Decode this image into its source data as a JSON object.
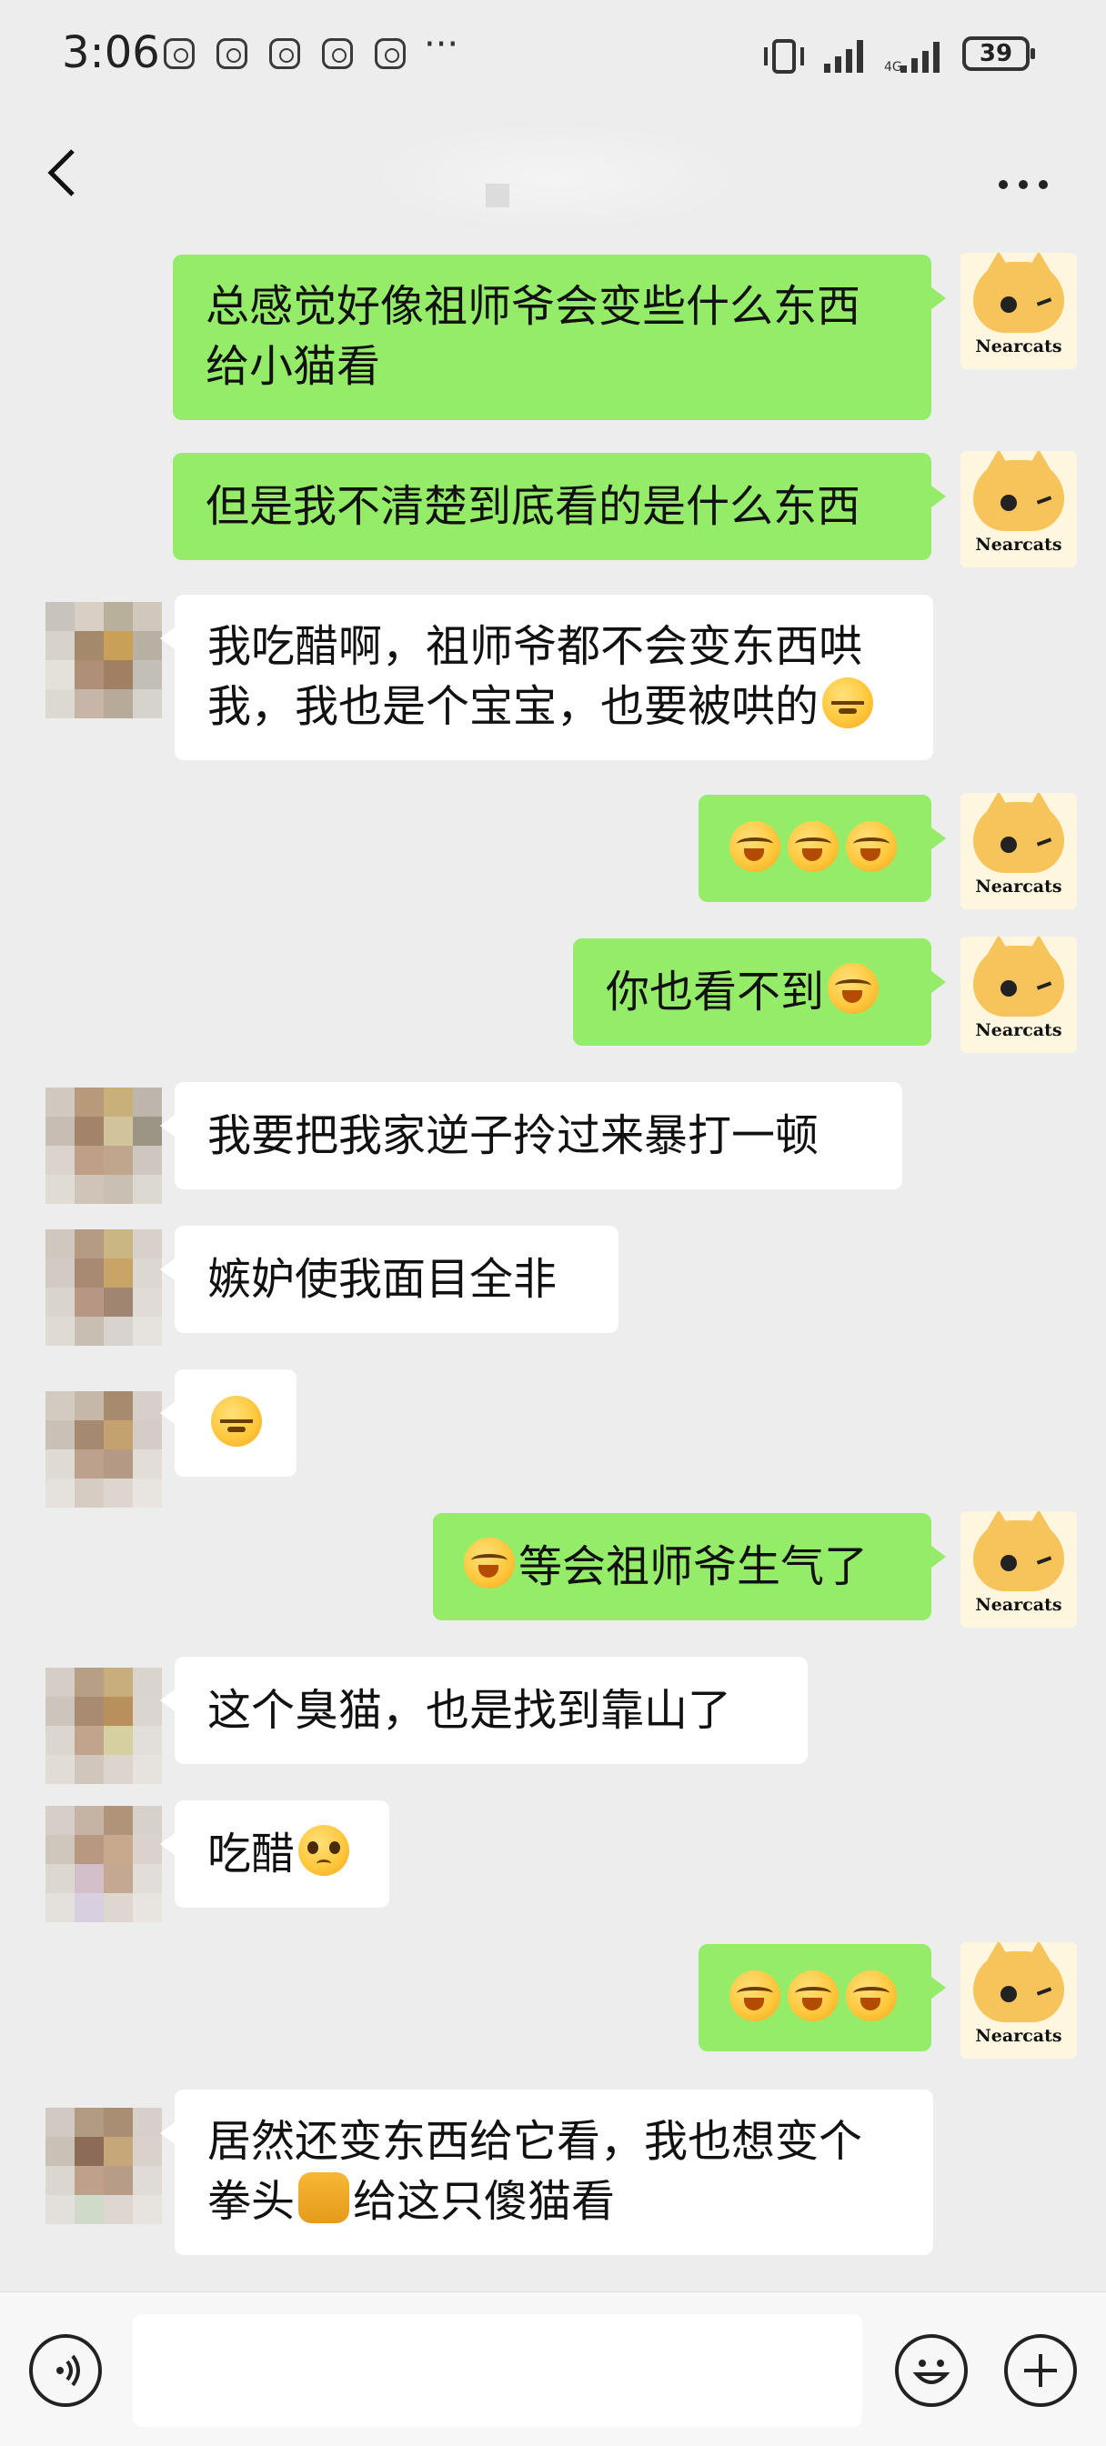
{
  "status_bar": {
    "time": "3:06",
    "overflow": "···",
    "battery": "39"
  },
  "header": {
    "back_icon": "chevron-left-icon",
    "menu_icon": "more-dots-icon"
  },
  "my_avatar_label": "Nearcats",
  "messages": [
    {
      "sender": "me",
      "lines": [
        "总感觉好像祖师爷会变些什么东西",
        "给小猫看"
      ]
    },
    {
      "sender": "me",
      "lines": [
        "但是我不清楚到底看的是什么东西"
      ]
    },
    {
      "sender": "them",
      "lines": [
        "我吃醋啊，祖师爷都不会变东西哄",
        "我，我也是个宝宝，也要被哄的"
      ],
      "emoji": "angry-crying-emoji"
    },
    {
      "sender": "me",
      "lines": [
        ""
      ],
      "emoji": "laughing-crying-emoji x3"
    },
    {
      "sender": "me",
      "lines": [
        "你也看不到"
      ],
      "emoji": "laughing-crying-emoji"
    },
    {
      "sender": "them",
      "lines": [
        "我要把我家逆子拎过来暴打一顿"
      ]
    },
    {
      "sender": "them",
      "lines": [
        "嫉妒使我面目全非"
      ]
    },
    {
      "sender": "them",
      "lines": [
        ""
      ],
      "emoji": "angry-crying-emoji"
    },
    {
      "sender": "me",
      "lines": [
        "等会祖师爷生气了"
      ],
      "emoji": "laughing-crying-emoji"
    },
    {
      "sender": "them",
      "lines": [
        "这个臭猫，也是找到靠山了"
      ]
    },
    {
      "sender": "them",
      "lines": [
        "吃醋"
      ],
      "emoji": "pleading-face-emoji"
    },
    {
      "sender": "me",
      "lines": [
        ""
      ],
      "emoji": "laughing-crying-emoji x3"
    },
    {
      "sender": "them",
      "lines": [
        "居然还变东西给它看，我也想变个",
        "拳头",
        "给这只傻猫看"
      ],
      "emoji": "fist-emoji"
    }
  ],
  "input_bar": {
    "voice_icon": "voice-icon",
    "emoji_icon": "emoji-icon",
    "plus_icon": "plus-icon",
    "input_value": ""
  }
}
